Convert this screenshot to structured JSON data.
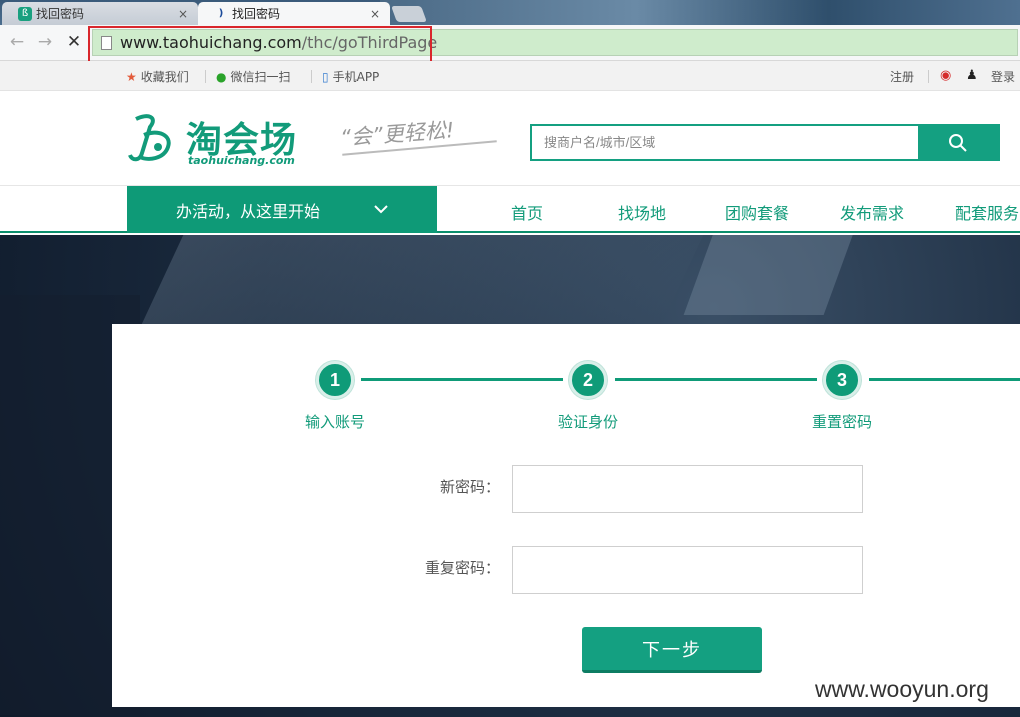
{
  "browser": {
    "tabs": [
      {
        "title": "找回密码",
        "active": false
      },
      {
        "title": "找回密码",
        "active": true
      }
    ],
    "close_glyph": "×",
    "url_domain": "www.taohuichang.com",
    "url_path": "/thc/goThirdPage",
    "bookmarks": [
      "收藏我们",
      "微信扫一扫",
      "手机APP"
    ],
    "register": "注册",
    "login": "登录"
  },
  "site": {
    "brand": "淘会场",
    "brand_sub": "taohuichang.com",
    "slogan": "“会”更轻松!",
    "search_placeholder": "搜商户名/城市/区域",
    "accent": "#14a081"
  },
  "nav": {
    "promo": "办活动，从这里开始",
    "items": [
      "首页",
      "找场地",
      "团购套餐",
      "发布需求",
      "配套服务"
    ]
  },
  "steps": [
    {
      "number": "1",
      "label": "输入账号"
    },
    {
      "number": "2",
      "label": "验证身份"
    },
    {
      "number": "3",
      "label": "重置密码"
    }
  ],
  "form": {
    "new_password_label": "新密码：",
    "new_password_value": "",
    "repeat_password_label": "重复密码：",
    "repeat_password_value": "",
    "submit_label": "下一步"
  },
  "watermark": "www.wooyun.org"
}
